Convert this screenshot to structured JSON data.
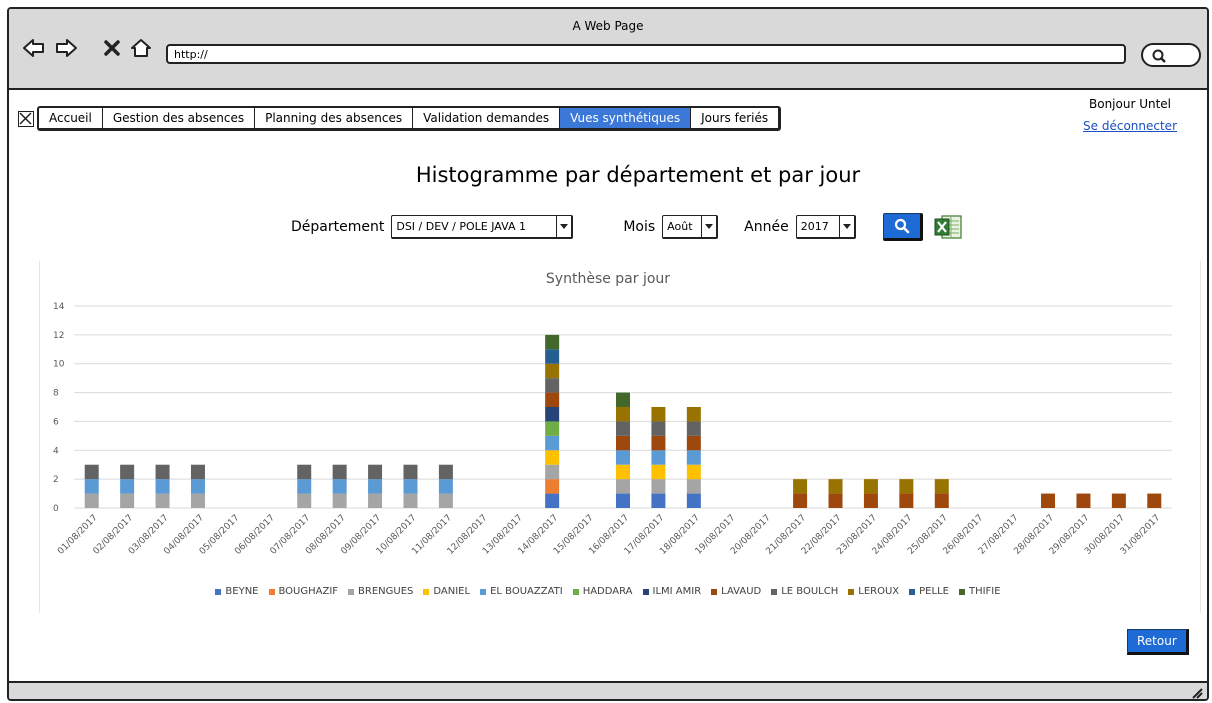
{
  "window": {
    "title": "A Web Page",
    "url": "http://"
  },
  "nav": {
    "tabs": [
      {
        "label": "Accueil",
        "active": false
      },
      {
        "label": "Gestion des absences",
        "active": false
      },
      {
        "label": "Planning des absences",
        "active": false
      },
      {
        "label": "Validation demandes",
        "active": false
      },
      {
        "label": "Vues synthétiques",
        "active": true
      },
      {
        "label": "Jours feriés",
        "active": false
      }
    ]
  },
  "user": {
    "greeting": "Bonjour Untel",
    "logout": "Se déconnecter"
  },
  "page": {
    "title": "Histogramme par département et par jour"
  },
  "filters": {
    "departement_label": "Département",
    "departement_value": "DSI / DEV / POLE JAVA 1",
    "mois_label": "Mois",
    "mois_value": "Août",
    "annee_label": "Année",
    "annee_value": "2017"
  },
  "actions": {
    "retour_label": "Retour"
  },
  "colors": {
    "accent": "#1f6bd6",
    "active_tab": "#3c78d8"
  },
  "chart_data": {
    "type": "bar",
    "stacked": true,
    "title": "Synthèse par jour",
    "ylim": [
      0,
      14
    ],
    "yticks": [
      0,
      2,
      4,
      6,
      8,
      10,
      12,
      14
    ],
    "grid": true,
    "legend_position": "bottom",
    "categories": [
      "01/08/2017",
      "02/08/2017",
      "03/08/2017",
      "04/08/2017",
      "05/08/2017",
      "06/08/2017",
      "07/08/2017",
      "08/08/2017",
      "09/08/2017",
      "10/08/2017",
      "11/08/2017",
      "12/08/2017",
      "13/08/2017",
      "14/08/2017",
      "15/08/2017",
      "16/08/2017",
      "17/08/2017",
      "18/08/2017",
      "19/08/2017",
      "20/08/2017",
      "21/08/2017",
      "22/08/2017",
      "23/08/2017",
      "24/08/2017",
      "25/08/2017",
      "26/08/2017",
      "27/08/2017",
      "28/08/2017",
      "29/08/2017",
      "30/08/2017",
      "31/08/2017"
    ],
    "series": [
      {
        "name": "BEYNE",
        "color": "#4472c4",
        "values": [
          0,
          0,
          0,
          0,
          0,
          0,
          0,
          0,
          0,
          0,
          0,
          0,
          0,
          1,
          0,
          1,
          1,
          1,
          0,
          0,
          0,
          0,
          0,
          0,
          0,
          0,
          0,
          0,
          0,
          0,
          0
        ]
      },
      {
        "name": "BOUGHAZIF",
        "color": "#ed7d31",
        "values": [
          0,
          0,
          0,
          0,
          0,
          0,
          0,
          0,
          0,
          0,
          0,
          0,
          0,
          1,
          0,
          0,
          0,
          0,
          0,
          0,
          0,
          0,
          0,
          0,
          0,
          0,
          0,
          0,
          0,
          0,
          0
        ]
      },
      {
        "name": "BRENGUES",
        "color": "#a5a5a5",
        "values": [
          1,
          1,
          1,
          1,
          0,
          0,
          1,
          1,
          1,
          1,
          1,
          0,
          0,
          1,
          0,
          1,
          1,
          1,
          0,
          0,
          0,
          0,
          0,
          0,
          0,
          0,
          0,
          0,
          0,
          0,
          0
        ]
      },
      {
        "name": "DANIEL",
        "color": "#ffc000",
        "values": [
          0,
          0,
          0,
          0,
          0,
          0,
          0,
          0,
          0,
          0,
          0,
          0,
          0,
          1,
          0,
          1,
          1,
          1,
          0,
          0,
          0,
          0,
          0,
          0,
          0,
          0,
          0,
          0,
          0,
          0,
          0
        ]
      },
      {
        "name": "EL BOUAZZATI",
        "color": "#5b9bd5",
        "values": [
          1,
          1,
          1,
          1,
          0,
          0,
          1,
          1,
          1,
          1,
          1,
          0,
          0,
          1,
          0,
          1,
          1,
          1,
          0,
          0,
          0,
          0,
          0,
          0,
          0,
          0,
          0,
          0,
          0,
          0,
          0
        ]
      },
      {
        "name": "HADDARA",
        "color": "#70ad47",
        "values": [
          0,
          0,
          0,
          0,
          0,
          0,
          0,
          0,
          0,
          0,
          0,
          0,
          0,
          1,
          0,
          0,
          0,
          0,
          0,
          0,
          0,
          0,
          0,
          0,
          0,
          0,
          0,
          0,
          0,
          0,
          0
        ]
      },
      {
        "name": "ILMI AMIR",
        "color": "#264478",
        "values": [
          0,
          0,
          0,
          0,
          0,
          0,
          0,
          0,
          0,
          0,
          0,
          0,
          0,
          1,
          0,
          0,
          0,
          0,
          0,
          0,
          0,
          0,
          0,
          0,
          0,
          0,
          0,
          0,
          0,
          0,
          0
        ]
      },
      {
        "name": "LAVAUD",
        "color": "#9e480e",
        "values": [
          0,
          0,
          0,
          0,
          0,
          0,
          0,
          0,
          0,
          0,
          0,
          0,
          0,
          1,
          0,
          1,
          1,
          1,
          0,
          0,
          1,
          1,
          1,
          1,
          1,
          0,
          0,
          1,
          1,
          1,
          1
        ]
      },
      {
        "name": "LE BOULCH",
        "color": "#636363",
        "values": [
          1,
          1,
          1,
          1,
          0,
          0,
          1,
          1,
          1,
          1,
          1,
          0,
          0,
          1,
          0,
          1,
          1,
          1,
          0,
          0,
          0,
          0,
          0,
          0,
          0,
          0,
          0,
          0,
          0,
          0,
          0
        ]
      },
      {
        "name": "LEROUX",
        "color": "#997300",
        "values": [
          0,
          0,
          0,
          0,
          0,
          0,
          0,
          0,
          0,
          0,
          0,
          0,
          0,
          1,
          0,
          1,
          1,
          1,
          0,
          0,
          1,
          1,
          1,
          1,
          1,
          0,
          0,
          0,
          0,
          0,
          0
        ]
      },
      {
        "name": "PELLE",
        "color": "#255e91",
        "values": [
          0,
          0,
          0,
          0,
          0,
          0,
          0,
          0,
          0,
          0,
          0,
          0,
          0,
          1,
          0,
          0,
          0,
          0,
          0,
          0,
          0,
          0,
          0,
          0,
          0,
          0,
          0,
          0,
          0,
          0,
          0
        ]
      },
      {
        "name": "THIFIE",
        "color": "#43682b",
        "values": [
          0,
          0,
          0,
          0,
          0,
          0,
          0,
          0,
          0,
          0,
          0,
          0,
          0,
          1,
          0,
          1,
          0,
          0,
          0,
          0,
          0,
          0,
          0,
          0,
          0,
          0,
          0,
          0,
          0,
          0,
          0
        ]
      }
    ]
  }
}
